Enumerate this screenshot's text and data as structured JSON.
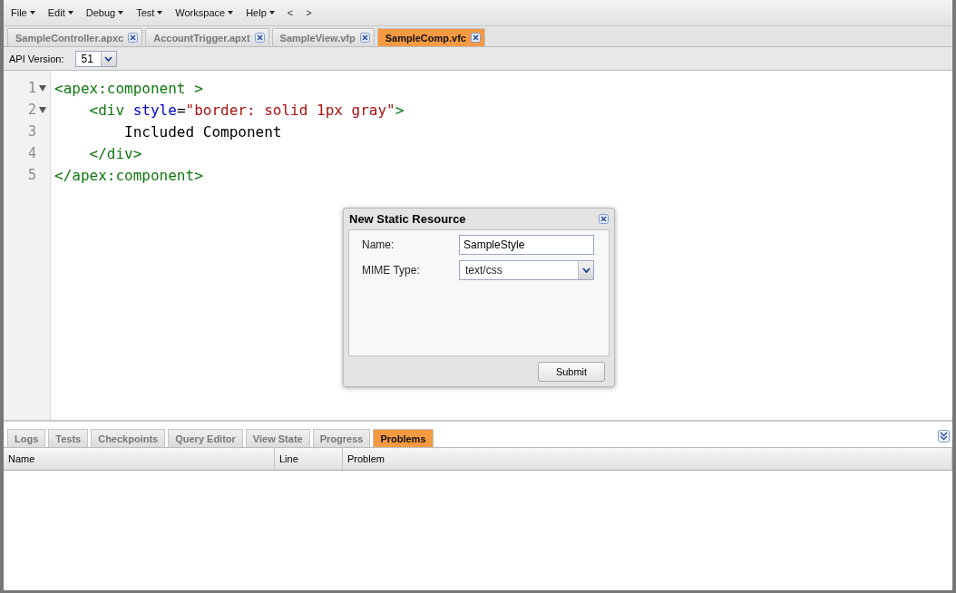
{
  "menu": [
    {
      "label": "File",
      "dropdown": true
    },
    {
      "label": "Edit",
      "dropdown": true
    },
    {
      "label": "Debug",
      "dropdown": true
    },
    {
      "label": "Test",
      "dropdown": true
    },
    {
      "label": "Workspace",
      "dropdown": true
    },
    {
      "label": "Help",
      "dropdown": true
    },
    {
      "label": "<",
      "dropdown": false
    },
    {
      "label": ">",
      "dropdown": false
    }
  ],
  "tabs": [
    {
      "label": "SampleController.apxc",
      "selected": false
    },
    {
      "label": "AccountTrigger.apxt",
      "selected": false
    },
    {
      "label": "SampleView.vfp",
      "selected": false
    },
    {
      "label": "SampleComp.vfc",
      "selected": true
    }
  ],
  "api_version": {
    "label": "API Version:",
    "value": "51"
  },
  "editor": {
    "lines": [
      {
        "number": "1",
        "foldable": true,
        "tokens": [
          {
            "kind": "tag",
            "text": "<apex:component >"
          }
        ]
      },
      {
        "number": "2",
        "foldable": true,
        "tokens": [
          {
            "kind": "tag",
            "text": "    <div "
          },
          {
            "kind": "attr",
            "text": "style"
          },
          {
            "kind": "plain",
            "text": "="
          },
          {
            "kind": "string",
            "text": "\"border: solid 1px gray\""
          },
          {
            "kind": "tag",
            "text": ">"
          }
        ]
      },
      {
        "number": "3",
        "foldable": false,
        "tokens": [
          {
            "kind": "plain",
            "text": "        Included Component"
          }
        ]
      },
      {
        "number": "4",
        "foldable": false,
        "tokens": [
          {
            "kind": "tag",
            "text": "    </div>"
          }
        ]
      },
      {
        "number": "5",
        "foldable": false,
        "tokens": [
          {
            "kind": "tag",
            "text": "</apex:component>"
          }
        ]
      }
    ]
  },
  "dialog": {
    "title": "New Static Resource",
    "fields": [
      {
        "label": "Name:",
        "kind": "text",
        "value": "SampleStyle"
      },
      {
        "label": "MIME Type:",
        "kind": "select",
        "value": "text/css"
      }
    ],
    "button": "Submit"
  },
  "bottom_tabs": [
    {
      "label": "Logs",
      "selected": false
    },
    {
      "label": "Tests",
      "selected": false
    },
    {
      "label": "Checkpoints",
      "selected": false
    },
    {
      "label": "Query Editor",
      "selected": false
    },
    {
      "label": "View State",
      "selected": false
    },
    {
      "label": "Progress",
      "selected": false
    },
    {
      "label": "Problems",
      "selected": true
    }
  ],
  "table": {
    "columns": [
      "Name",
      "Line",
      "Problem"
    ]
  }
}
